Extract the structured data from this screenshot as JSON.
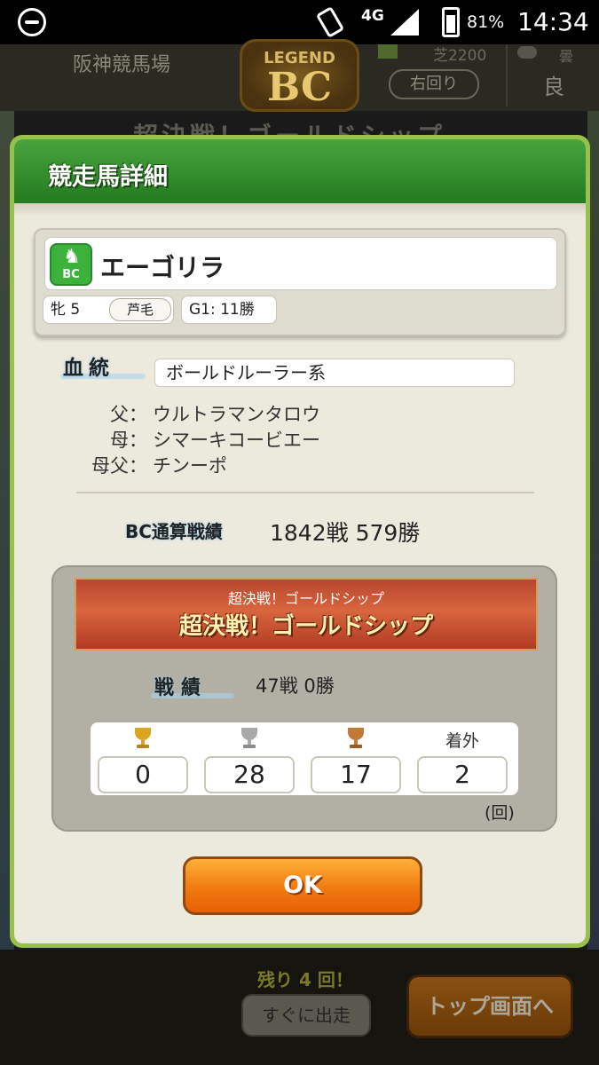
{
  "status_bar": {
    "network": "4G",
    "battery": "81%",
    "time": "14:34"
  },
  "background": {
    "venue": "阪神競馬場",
    "logo_top": "LEGEND",
    "logo_main": "BC",
    "distance": "芝2200",
    "direction": "右回り",
    "weather": "曇",
    "condition": "良",
    "event_title": "超決戦！ゴールドシップ",
    "remaining": "残り 4 回！",
    "start_button": "すぐに出走",
    "top_button": "トップ画面へ"
  },
  "modal": {
    "title": "競走馬詳細",
    "horse": {
      "badge": "BC",
      "name": "エーゴリラ",
      "sex_age": "牝 5",
      "coat": "芦毛",
      "g1": "G1: 11勝"
    },
    "pedigree": {
      "label": "血統",
      "line": "ボールドルーラー系",
      "rows": [
        {
          "key": "父：",
          "value": "ウルトラマンタロウ"
        },
        {
          "key": "母：",
          "value": "シマーキコービエー"
        },
        {
          "key": "母父：",
          "value": "チンーポ"
        }
      ]
    },
    "bc_record": {
      "label": "BC通算戦績",
      "value": "1842戦 579勝"
    },
    "event": {
      "small_title": "超決戦！ゴールドシップ",
      "main_title": "超決戦！ゴールドシップ",
      "record_label": "戦績",
      "record_value": "47戦 0勝",
      "places": [
        {
          "head": "gold-trophy",
          "value": "0"
        },
        {
          "head": "silver-trophy",
          "value": "28"
        },
        {
          "head": "bronze-trophy",
          "value": "17"
        },
        {
          "head_text": "着外",
          "value": "2"
        }
      ],
      "unit": "(回)"
    },
    "ok_button": "OK"
  },
  "colors": {
    "modal_border": "#97c14a",
    "header_green": "#2f8a2a",
    "ok_orange": "#f07a10",
    "banner_red": "#c24e32"
  }
}
